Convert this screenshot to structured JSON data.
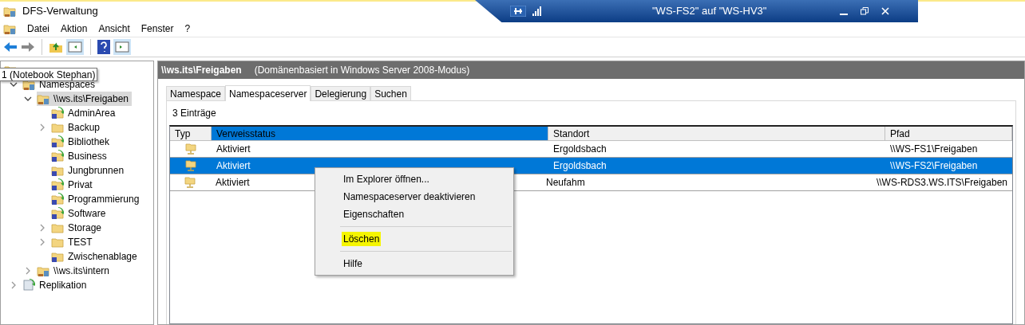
{
  "window": {
    "title": "DFS-Verwaltung"
  },
  "remote_bar": {
    "title": "\"WS-FS2\" auf \"WS-HV3\""
  },
  "menu": [
    "Datei",
    "Aktion",
    "Ansicht",
    "Fenster",
    "?"
  ],
  "tooltip": "1 (Notebook Stephan)",
  "tree": [
    {
      "label": "Namespaces",
      "kind": "namespaces",
      "expanded": true,
      "selected": false,
      "children": [
        {
          "label": "\\\\ws.its\\Freigaben",
          "kind": "namespace",
          "expanded": true,
          "selected": true,
          "children": [
            {
              "label": "AdminArea",
              "kind": "link",
              "expandable": false
            },
            {
              "label": "Backup",
              "kind": "folder",
              "expandable": true
            },
            {
              "label": "Bibliothek",
              "kind": "link",
              "expandable": false
            },
            {
              "label": "Business",
              "kind": "link",
              "expandable": false
            },
            {
              "label": "Jungbrunnen",
              "kind": "linkfolder",
              "expandable": false
            },
            {
              "label": "Privat",
              "kind": "link",
              "expandable": false
            },
            {
              "label": "Programmierung",
              "kind": "link",
              "expandable": false
            },
            {
              "label": "Software",
              "kind": "link",
              "expandable": false
            },
            {
              "label": "Storage",
              "kind": "folder",
              "expandable": true
            },
            {
              "label": "TEST",
              "kind": "folder",
              "expandable": true
            },
            {
              "label": "Zwischenablage",
              "kind": "linkfolder",
              "expandable": false
            }
          ]
        },
        {
          "label": "\\\\ws.its\\intern",
          "kind": "namespace",
          "expanded": false,
          "selected": false
        }
      ]
    },
    {
      "label": "Replikation",
      "kind": "replication",
      "expanded": false,
      "selected": false
    }
  ],
  "header": {
    "title": "\\\\ws.its\\Freigaben",
    "subtitle": "(Domänenbasiert in Windows Server 2008-Modus)"
  },
  "tabs": [
    {
      "label": "Namespace",
      "selected": false
    },
    {
      "label": "Namespaceserver",
      "selected": true
    },
    {
      "label": "Delegierung",
      "selected": false
    },
    {
      "label": "Suchen",
      "selected": false
    }
  ],
  "count": "3 Einträge",
  "table": {
    "columns": [
      {
        "label": "Typ",
        "selected": false
      },
      {
        "label": "Verweisstatus",
        "selected": true
      },
      {
        "label": "Standort",
        "selected": false
      },
      {
        "label": "Pfad",
        "selected": false
      }
    ],
    "rows": [
      {
        "status": "Aktiviert",
        "location": "Ergoldsbach",
        "path": "\\\\WS-FS1\\Freigaben",
        "selected": false
      },
      {
        "status": "Aktiviert",
        "location": "Ergoldsbach",
        "path": "\\\\WS-FS2\\Freigaben",
        "selected": true
      },
      {
        "status": "Aktiviert",
        "location": "Neufahm",
        "path": "\\\\WS-RDS3.WS.ITS\\Freigaben",
        "selected": false
      }
    ]
  },
  "context_menu": [
    {
      "label": "Im Explorer öffnen...",
      "highlighted": false,
      "separator_before": false
    },
    {
      "label": "Namespaceserver deaktivieren",
      "highlighted": false,
      "separator_before": false
    },
    {
      "label": "Eigenschaften",
      "highlighted": false,
      "separator_before": false
    },
    {
      "label": "Löschen",
      "highlighted": true,
      "separator_before": true
    },
    {
      "label": "Hilfe",
      "highlighted": false,
      "separator_before": true
    }
  ]
}
